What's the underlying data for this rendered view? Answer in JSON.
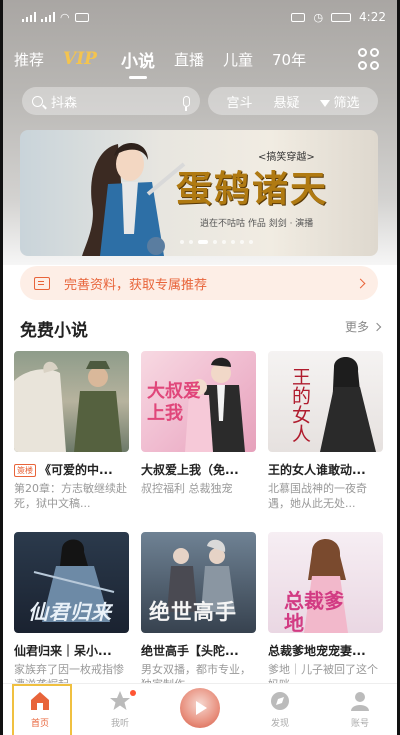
{
  "status_bar": {
    "time": "4:22"
  },
  "tabs": [
    {
      "label": "推荐"
    },
    {
      "label": "VIP"
    },
    {
      "label": "小说",
      "active": true
    },
    {
      "label": "直播"
    },
    {
      "label": "儿童"
    },
    {
      "label": "70年"
    }
  ],
  "search": {
    "value": "抖森"
  },
  "filters": {
    "tag1": "宫斗",
    "tag2": "悬疑",
    "filter_label": "筛选"
  },
  "banner": {
    "title": "蛋鸫诸天",
    "subtitle": "<搞笑穿越>",
    "author_line": "逍在不咕咕 作品 剡剑 · 演播"
  },
  "promo": {
    "text": "完善资料，获取专属推荐"
  },
  "section": {
    "title": "免费小说",
    "more_label": "更多"
  },
  "books": [
    {
      "title": "《可爱的中...",
      "tag": "簽楼",
      "desc": "第20章：方志敏继续赴死，狱中文稿..."
    },
    {
      "title": "大叔爱上我（免...",
      "desc": "叔控福利 总裁独宠"
    },
    {
      "title": "王的女人谁敢动...",
      "desc": "北慕国战神的一夜奇遇，她从此无处..."
    },
    {
      "title": "仙君归来｜呆小...",
      "desc": "家族弃了因一枚戒指惨遭逆袭崛起..."
    },
    {
      "title": "绝世高手【头陀...",
      "desc": "男女双播，都市专业，独家制作..."
    },
    {
      "title": "总裁爹地宠宠妻...",
      "desc": "爹地｜儿子被回了这个妈咪..."
    }
  ],
  "cover_text": {
    "book2": "大叔爱上我",
    "book3": "王的女人",
    "book4": "仙君归来",
    "book5": "绝世高手",
    "book6": "总裁爹地"
  },
  "bottom_nav": [
    {
      "label": "首页",
      "active": true
    },
    {
      "label": "我听"
    },
    {
      "label": ""
    },
    {
      "label": "发现"
    },
    {
      "label": "账号"
    }
  ],
  "colors": {
    "accent": "#e8643a",
    "vip_gold": "#f4c44e",
    "promo_bg": "#fdeee6"
  }
}
